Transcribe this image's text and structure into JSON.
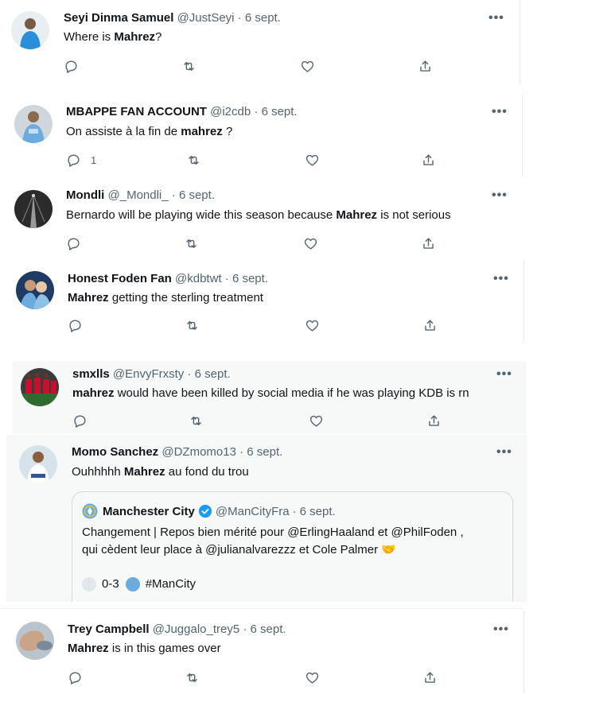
{
  "tweets": [
    {
      "name": "Seyi Dinma Samuel",
      "handle": "@JustSeyi",
      "sep": "·",
      "date": "6 sept.",
      "more": "•••",
      "text": [
        {
          "t": "Where is "
        },
        {
          "t": "Mahrez",
          "b": true
        },
        {
          "t": "?"
        }
      ],
      "reply_count": ""
    },
    {
      "name": "MBAPPE FAN ACCOUNT",
      "handle": "@i2cdb",
      "sep": "·",
      "date": "6 sept.",
      "more": "•••",
      "text": [
        {
          "t": "On assiste à la fin de "
        },
        {
          "t": "mahrez",
          "b": true
        },
        {
          "t": " ?"
        }
      ],
      "reply_count": "1"
    },
    {
      "name": "Mondli",
      "handle": "@_Mondli_",
      "sep": "·",
      "date": "6 sept.",
      "more": "•••",
      "text": [
        {
          "t": "Bernardo will be playing wide this season because "
        },
        {
          "t": "Mahrez",
          "b": true
        },
        {
          "t": " is not serious"
        }
      ],
      "reply_count": ""
    },
    {
      "name": "Honest Foden Fan",
      "handle": "@kdbtwt",
      "sep": "·",
      "date": "6 sept.",
      "more": "•••",
      "text": [
        {
          "t": "Mahrez",
          "b": true
        },
        {
          "t": " getting the sterling treatment"
        }
      ],
      "reply_count": ""
    },
    {
      "name": "smxlls",
      "handle": "@EnvyFrxsty",
      "sep": "·",
      "date": "6 sept.",
      "more": "•••",
      "text": [
        {
          "t": "mahrez",
          "b": true
        },
        {
          "t": " would have been killed by social media if he was playing KDB is rn"
        }
      ],
      "reply_count": ""
    },
    {
      "name": "Momo Sanchez",
      "handle": "@DZmomo13",
      "sep": "·",
      "date": "6 sept.",
      "more": "•••",
      "text": [
        {
          "t": "Ouhhhhh "
        },
        {
          "t": "Mahrez",
          "b": true
        },
        {
          "t": " au fond du trou"
        }
      ],
      "reply_count": "",
      "quote": {
        "name": "Manchester City",
        "handle": "@ManCityFra",
        "sep": "·",
        "date": "6 sept.",
        "line1": "Changement | Repos bien mérité pour @ErlingHaaland et @PhilFoden ,",
        "line2": "qui cèdent leur place à @julianalvarezzz et Cole Palmer 🤝",
        "score": "0-3",
        "hashtag": "#ManCity"
      }
    },
    {
      "name": "Trey Campbell",
      "handle": "@Juggalo_trey5",
      "sep": "·",
      "date": "6 sept.",
      "more": "•••",
      "text": [
        {
          "t": "Mahrez",
          "b": true
        },
        {
          "t": " is in this games over"
        }
      ],
      "reply_count": ""
    }
  ],
  "colors": {
    "muted": "#536471",
    "verified": "#1d9bf0",
    "city_blue": "#6cabdd"
  }
}
